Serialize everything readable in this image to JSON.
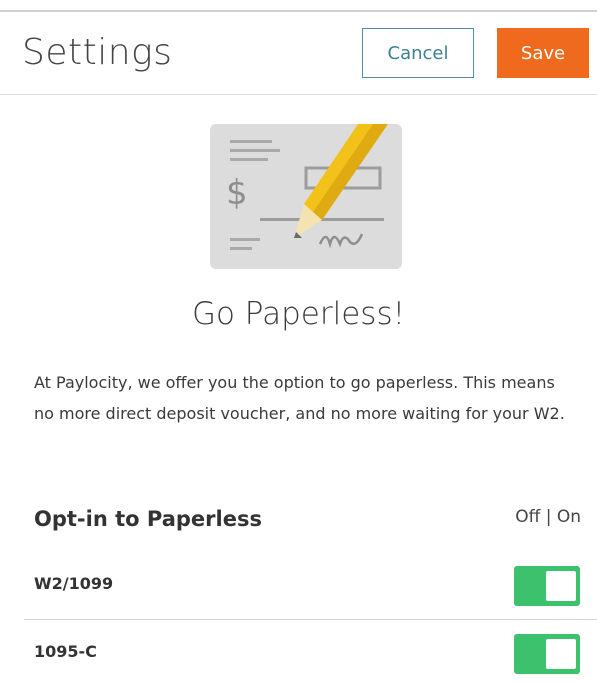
{
  "header": {
    "title": "Settings",
    "cancel_label": "Cancel",
    "save_label": "Save"
  },
  "hero": {
    "icon": "check-with-pencil-icon",
    "headline": "Go Paperless!",
    "description": "At Paylocity, we offer you the option to go paperless. This means no more direct deposit voucher, and no more waiting for your W2."
  },
  "opt_in": {
    "title": "Opt-in to Paperless",
    "off_on_label": "Off | On",
    "items": [
      {
        "label": "W2/1099",
        "state": "on"
      },
      {
        "label": "1095-C",
        "state": "on"
      }
    ]
  },
  "colors": {
    "accent_save": "#ef6a1d",
    "cancel_border": "#4c8fa3",
    "toggle_on": "#3cc16c"
  }
}
